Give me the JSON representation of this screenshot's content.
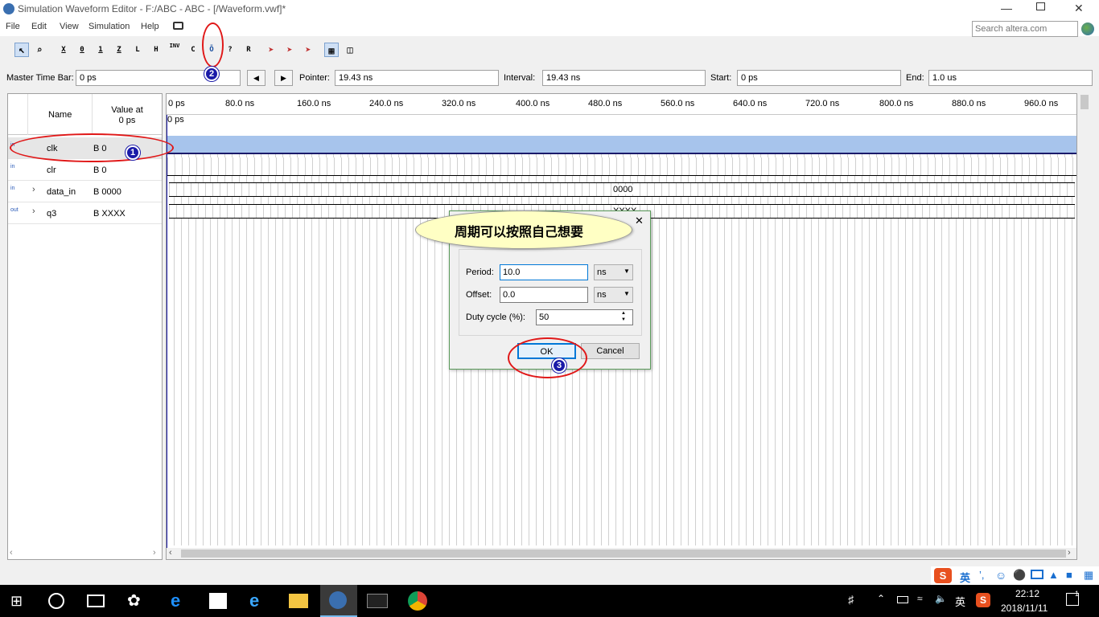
{
  "window": {
    "title": "Simulation Waveform Editor - F:/ABC - ABC - [/Waveform.vwf]*"
  },
  "menu": [
    "File",
    "Edit",
    "View",
    "Simulation",
    "Help"
  ],
  "search": {
    "placeholder": "Search altera.com"
  },
  "toolbar": {
    "labels": [
      "X",
      "0",
      "1",
      "Z",
      "L",
      "H",
      "INV",
      "C",
      "Ō",
      "?",
      "R"
    ]
  },
  "timebar": {
    "master_label": "Master Time Bar:",
    "master_value": "0 ps",
    "pointer_label": "Pointer:",
    "pointer_value": "19.43 ns",
    "interval_label": "Interval:",
    "interval_value": "19.43 ns",
    "start_label": "Start:",
    "start_value": "0 ps",
    "end_label": "End:",
    "end_value": "1.0 us"
  },
  "signals": {
    "header_name": "Name",
    "header_value": "Value at\n0 ps",
    "rows": [
      {
        "dir": "in",
        "name": "clk",
        "value": "B 0"
      },
      {
        "dir": "in",
        "name": "clr",
        "value": "B 0"
      },
      {
        "dir": "in",
        "name": "data_in",
        "value": "B 0000"
      },
      {
        "dir": "out",
        "name": "q3",
        "value": "B XXXX"
      }
    ]
  },
  "timeline": {
    "ticks": [
      "0 ps",
      "80.0 ns",
      "160.0 ns",
      "240.0 ns",
      "320.0 ns",
      "400.0 ns",
      "480.0 ns",
      "560.0 ns",
      "640.0 ns",
      "720.0 ns",
      "800.0 ns",
      "880.0 ns",
      "960.0 ns"
    ],
    "cursor_label": "0 ps",
    "data_in_value": "0000",
    "q3_value": "XXXX"
  },
  "dialog": {
    "period_label": "Period:",
    "period_value": "10.0",
    "period_unit": "ns",
    "offset_label": "Offset:",
    "offset_value": "0.0",
    "offset_unit": "ns",
    "duty_label": "Duty cycle (%):",
    "duty_value": "50",
    "ok": "OK",
    "cancel": "Cancel",
    "close": "✕"
  },
  "callout": {
    "text": "周期可以按照自己想要"
  },
  "badges": [
    "1",
    "2",
    "3"
  ],
  "ime": {
    "lang1": "英",
    "lang2": "英"
  },
  "clock": {
    "time": "22:12",
    "date": "2018/11/11"
  },
  "notif_count": "1"
}
